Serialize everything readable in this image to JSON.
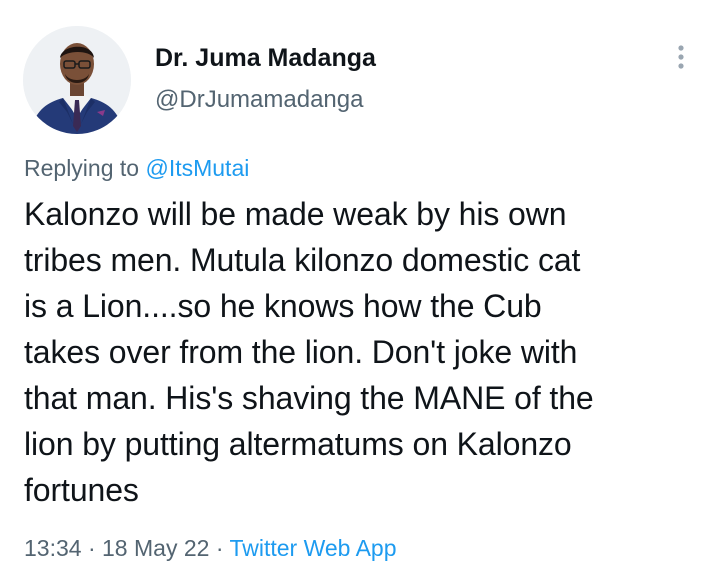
{
  "author": {
    "display_name": "Dr. Juma Madanga",
    "handle": "@DrJumamadanga",
    "avatar_icon": "profile-photo"
  },
  "menu": {
    "more_icon": "more-vertical-icon"
  },
  "reply": {
    "prefix": "Replying to",
    "mention": "@ItsMutai"
  },
  "tweet": {
    "lines": [
      "Kalonzo will be made weak by his own",
      "tribes men. Mutula kilonzo domestic cat",
      "is a Lion....so he knows how the Cub",
      "takes over from the lion. Don't joke with",
      "that man. His's shaving the MANE of the",
      "lion by putting altermatums on Kalonzo",
      "fortunes"
    ]
  },
  "meta": {
    "time": "13:34",
    "separator": "·",
    "date": "18 May 22",
    "source": "Twitter Web App"
  },
  "colors": {
    "text_primary": "#0f1419",
    "text_secondary": "#536471",
    "link": "#1d9bf0"
  }
}
